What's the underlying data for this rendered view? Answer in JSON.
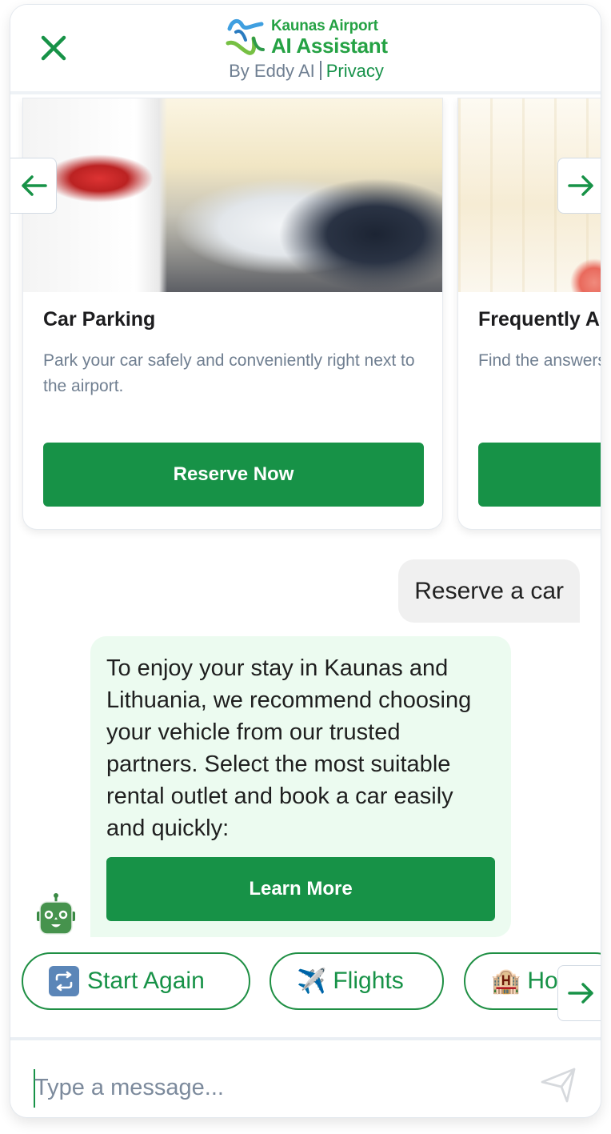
{
  "header": {
    "brand_line1": "Kaunas Airport",
    "brand_line2": "AI Assistant",
    "byline": "By Eddy AI",
    "privacy_link": "Privacy",
    "close_icon": "close-icon"
  },
  "carousel": {
    "prev_icon": "arrow-left-icon",
    "next_icon": "arrow-right-icon",
    "cards": [
      {
        "title": "Car Parking",
        "description": "Park your car safely and conveniently right next to the airport.",
        "button": "Reserve Now",
        "image": "parked-cars-photo"
      },
      {
        "title": "Frequently Asked Questions",
        "description": "Find the answers",
        "button": "",
        "image": "airport-terminal-photo"
      }
    ]
  },
  "messages": [
    {
      "role": "user",
      "text": "Reserve a car"
    },
    {
      "role": "bot",
      "text": "To enjoy your stay in Kaunas and Lithuania, we recommend choosing your vehicle from our trusted partners. Select the most suitable rental outlet and book a car easily and quickly:",
      "button": "Learn More",
      "avatar": "robot-avatar-icon"
    }
  ],
  "quick_replies": [
    {
      "emoji": "🔁",
      "label": "Start Again"
    },
    {
      "emoji": "✈️",
      "label": "Flights"
    },
    {
      "emoji": "🏨",
      "label": "Hotels"
    }
  ],
  "composer": {
    "placeholder": "Type a message...",
    "value": "",
    "send_icon": "send-icon"
  },
  "colors": {
    "brand_green": "#179247",
    "logo_green": "#25a244",
    "bot_bubble": "#ecfbf0",
    "user_bubble": "#f0f0f0",
    "muted_text": "#707f91"
  }
}
